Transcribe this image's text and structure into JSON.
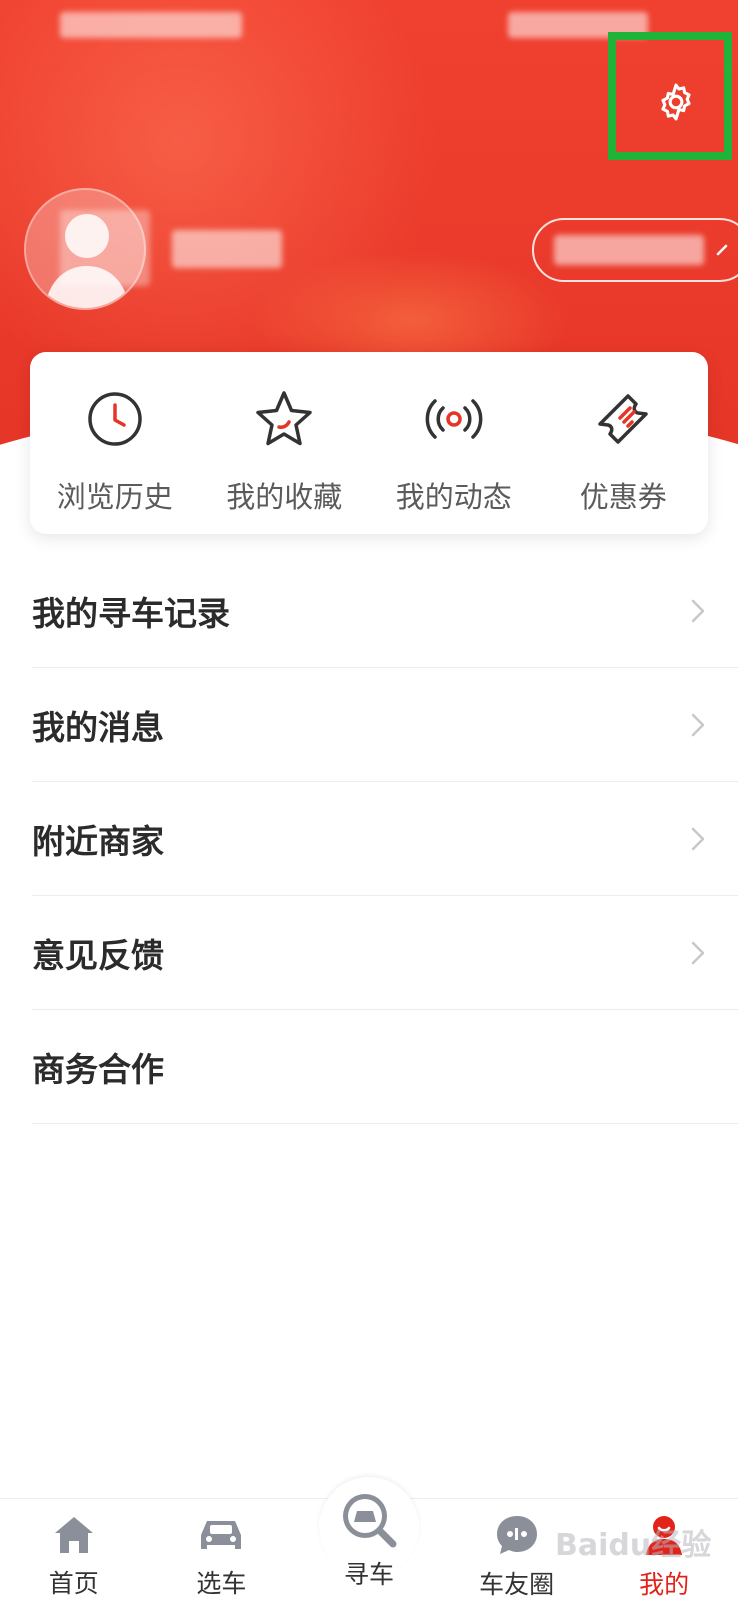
{
  "quick_actions": [
    {
      "label": "浏览历史",
      "icon": "clock-icon"
    },
    {
      "label": "我的收藏",
      "icon": "star-icon"
    },
    {
      "label": "我的动态",
      "icon": "broadcast-icon"
    },
    {
      "label": "优惠券",
      "icon": "coupon-icon"
    }
  ],
  "menu": [
    {
      "label": "我的寻车记录",
      "has_chevron": true
    },
    {
      "label": "我的消息",
      "has_chevron": true
    },
    {
      "label": "附近商家",
      "has_chevron": true
    },
    {
      "label": "意见反馈",
      "has_chevron": true
    },
    {
      "label": "商务合作",
      "has_chevron": false
    }
  ],
  "tabbar": [
    {
      "label": "首页",
      "icon": "home-icon",
      "active": false
    },
    {
      "label": "选车",
      "icon": "car-icon",
      "active": false
    },
    {
      "label": "寻车",
      "icon": "car-search-icon",
      "active": false
    },
    {
      "label": "车友圈",
      "icon": "chat-icon",
      "active": false
    },
    {
      "label": "我的",
      "icon": "profile-icon",
      "active": true
    }
  ],
  "header": {
    "settings_icon": "gear-icon"
  },
  "watermark": "Baidu经验",
  "colors": {
    "brand": "#e53527",
    "active_tab": "#e2231a",
    "highlight": "#1fb33a"
  }
}
